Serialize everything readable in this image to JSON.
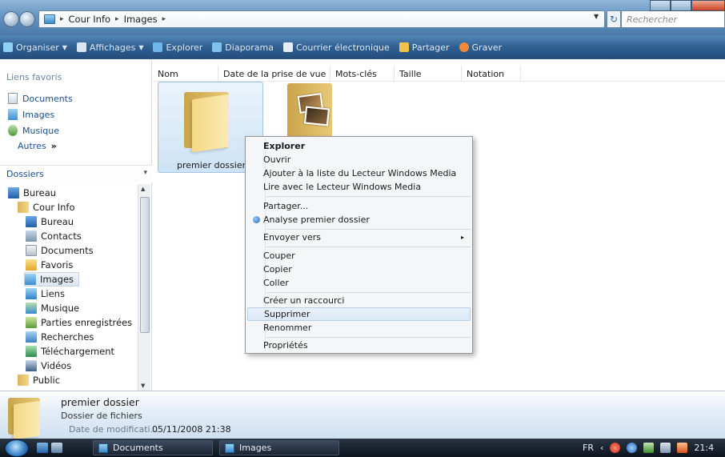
{
  "address": {
    "crumbs": [
      "Cour Info",
      "Images"
    ],
    "search_placeholder": "Rechercher"
  },
  "command_bar": {
    "items": [
      "Organiser",
      "Affichages",
      "Explorer",
      "Diaporama",
      "Courrier électronique",
      "Partager",
      "Graver"
    ]
  },
  "favorites": {
    "title": "Liens favoris",
    "items": [
      "Documents",
      "Images",
      "Musique"
    ],
    "more": "Autres",
    "more_icon": "double-chevron-icon"
  },
  "folders": {
    "title": "Dossiers",
    "tree": [
      {
        "label": "Bureau",
        "level": 0
      },
      {
        "label": "Cour Info",
        "level": 1
      },
      {
        "label": "Bureau",
        "level": 2
      },
      {
        "label": "Contacts",
        "level": 2
      },
      {
        "label": "Documents",
        "level": 2
      },
      {
        "label": "Favoris",
        "level": 2
      },
      {
        "label": "Images",
        "level": 2,
        "selected": true
      },
      {
        "label": "Liens",
        "level": 2
      },
      {
        "label": "Musique",
        "level": 2
      },
      {
        "label": "Parties enregistrées",
        "level": 2
      },
      {
        "label": "Recherches",
        "level": 2
      },
      {
        "label": "Téléchargement",
        "level": 2
      },
      {
        "label": "Vidéos",
        "level": 2
      },
      {
        "label": "Public",
        "level": 1
      }
    ]
  },
  "columns": [
    "Nom",
    "Date de la prise de vue",
    "Mots-clés",
    "Taille",
    "Notation"
  ],
  "items": [
    {
      "label": "premier dossier",
      "selected": true
    }
  ],
  "context_menu": {
    "default_item": "Explorer",
    "items": [
      "Ouvrir",
      "Ajouter à la liste du Lecteur Windows Media",
      "Lire avec le Lecteur Windows Media",
      "Partager...",
      "Analyse premier dossier",
      "Envoyer vers",
      "Couper",
      "Copier",
      "Coller",
      "Créer un raccourci",
      "Supprimer",
      "Renommer",
      "Propriétés"
    ],
    "highlighted": "Supprimer"
  },
  "details": {
    "name": "premier dossier",
    "type": "Dossier de fichiers",
    "date_label": "Date de modificati...",
    "date_value": "05/11/2008 21:38"
  },
  "taskbar": {
    "tasks": [
      "Documents",
      "Images"
    ],
    "lang": "FR",
    "clock": "21:4"
  },
  "colors": {
    "command_bar": "#2f5f91",
    "selection": "#cde3f5",
    "link": "#1a4f8f"
  }
}
